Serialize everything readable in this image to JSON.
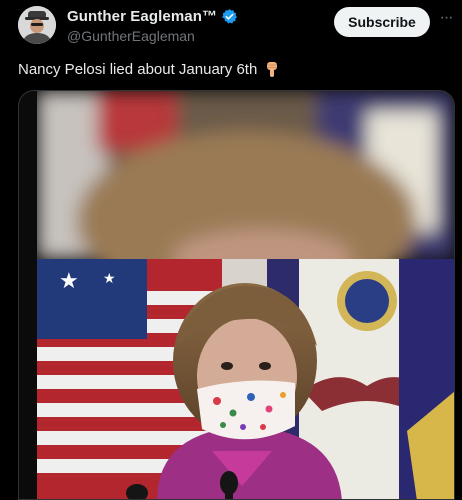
{
  "author": {
    "display_name": "Gunther Eagleman™",
    "handle": "@GuntherEagleman",
    "verified": true,
    "avatar_icon": "profile-avatar"
  },
  "actions": {
    "subscribe_label": "Subscribe",
    "more_icon": "more-horizontal-icon",
    "more_glyph": "···"
  },
  "tweet": {
    "text": "Nancy Pelosi lied about January 6th",
    "emoji": "backhand-index-pointing-down"
  },
  "media": {
    "type": "video-still",
    "description_icon": "media-preview"
  },
  "colors": {
    "background": "#000000",
    "primary_text": "#e7e9ea",
    "secondary_text": "#71767b",
    "verified_blue": "#1d9bf0",
    "subscribe_bg": "#eff3f4",
    "border": "#2f3336"
  }
}
